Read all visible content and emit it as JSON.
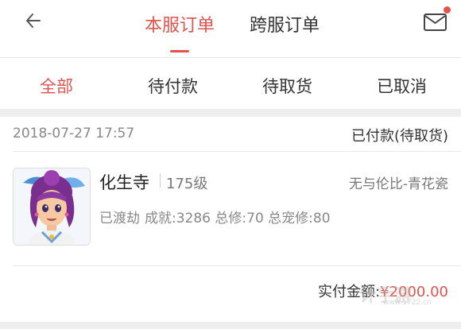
{
  "colors": {
    "accent": "#e0534e",
    "text_primary": "#333333",
    "text_secondary": "#888888",
    "divider": "#eeeeee"
  },
  "header": {
    "back_icon": "arrow-left-icon",
    "tabs": [
      {
        "label": "本服订单",
        "active": true
      },
      {
        "label": "跨服订单",
        "active": false
      }
    ],
    "mail_icon": "mail-icon",
    "mail_has_notification": true
  },
  "filters": [
    {
      "label": "全部",
      "active": true
    },
    {
      "label": "待付款",
      "active": false
    },
    {
      "label": "待取货",
      "active": false
    },
    {
      "label": "已取消",
      "active": false
    }
  ],
  "order": {
    "datetime": "2018-07-27 17:57",
    "status": "已付款(待取货)",
    "character": {
      "name": "化生寺",
      "level": "175级",
      "server": "无与伦比-青花瓷",
      "stats_label": "已渡劫",
      "stats": "成就:3286 总修:70 总宠修:80"
    },
    "payment": {
      "label": "实付金额:",
      "amount": "¥2000.00"
    }
  },
  "watermark": {
    "text": "计手游",
    "url": "www.1722.cn"
  }
}
